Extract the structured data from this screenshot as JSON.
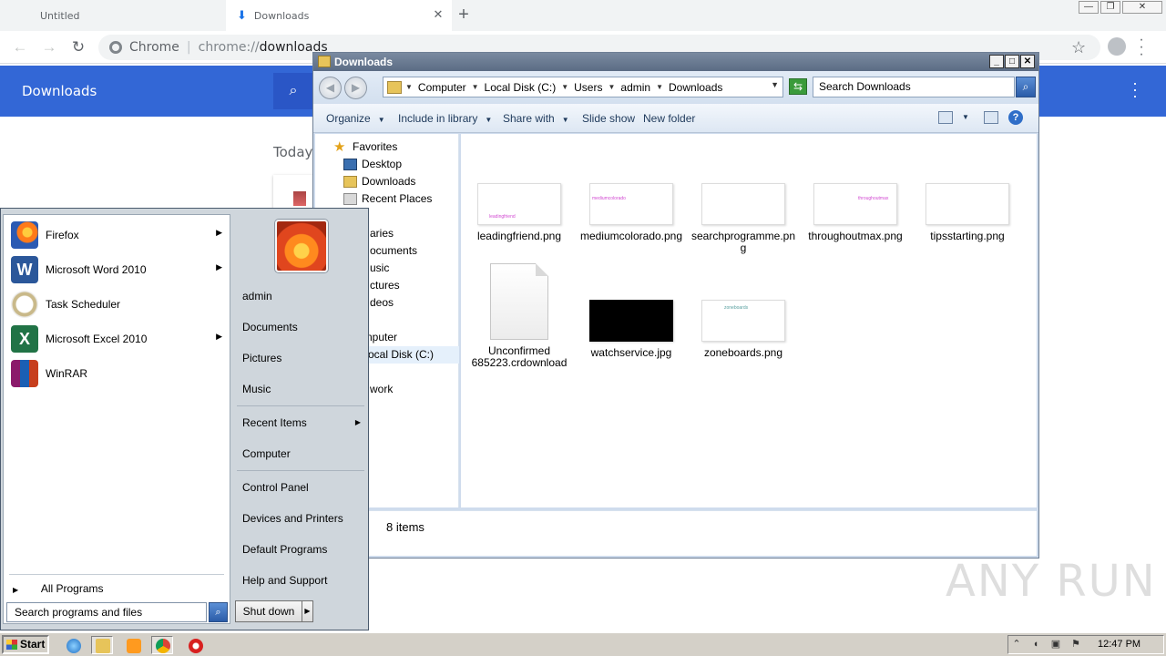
{
  "chrome": {
    "tabs": [
      {
        "label": "Untitled"
      },
      {
        "label": "Downloads"
      }
    ],
    "new_tab": "+",
    "omnibox": {
      "site_label": "Chrome",
      "url_scheme": "chrome://",
      "url_path": "downloads"
    },
    "downloads_page": {
      "title": "Downloads",
      "section": "Today"
    }
  },
  "explorer": {
    "title": "Downloads",
    "breadcrumb": [
      "Computer",
      "Local Disk (C:)",
      "Users",
      "admin",
      "Downloads"
    ],
    "search_placeholder": "Search Downloads",
    "commands": {
      "organize": "Organize",
      "include": "Include in library",
      "share": "Share with",
      "slideshow": "Slide show",
      "newfolder": "New folder"
    },
    "nav": {
      "favorites": "Favorites",
      "desktop": "Desktop",
      "downloads": "Downloads",
      "recent": "Recent Places",
      "libraries": "aries",
      "documents": "ocuments",
      "music": "usic",
      "pictures": "ctures",
      "videos": "deos",
      "computer": "nputer",
      "localdisk": "ocal Disk (C:)",
      "network": "work"
    },
    "files": [
      {
        "name": "leadingfriend.png",
        "mini": "leadingfriend"
      },
      {
        "name": "mediumcolorado.png",
        "mini": "mediumcolorado"
      },
      {
        "name": "searchprogramme.png",
        "mini": ""
      },
      {
        "name": "throughoutmax.png",
        "mini": "throughoutmax"
      },
      {
        "name": "tipsstarting.png",
        "mini": ""
      },
      {
        "name": "Unconfirmed 685223.crdownload",
        "mini": ""
      },
      {
        "name": "watchservice.jpg",
        "mini": ""
      },
      {
        "name": "zoneboards.png",
        "mini": "zoneboards"
      }
    ],
    "status": "8 items"
  },
  "startmenu": {
    "programs": [
      {
        "label": "Firefox",
        "icon": "firefox-icon"
      },
      {
        "label": "Microsoft Word 2010",
        "icon": "word-icon"
      },
      {
        "label": "Task Scheduler",
        "icon": "task-scheduler-icon"
      },
      {
        "label": "Microsoft Excel 2010",
        "icon": "excel-icon"
      },
      {
        "label": "WinRAR",
        "icon": "winrar-icon"
      }
    ],
    "all_programs": "All Programs",
    "search_placeholder": "Search programs and files",
    "right": {
      "user": "admin",
      "documents": "Documents",
      "pictures": "Pictures",
      "music": "Music",
      "recent": "Recent Items",
      "computer": "Computer",
      "control_panel": "Control Panel",
      "devices": "Devices and Printers",
      "default_programs": "Default Programs",
      "help": "Help and Support"
    },
    "shutdown": "Shut down"
  },
  "taskbar": {
    "start": "Start",
    "clock": "12:47 PM"
  },
  "watermark": "ANY RUN"
}
